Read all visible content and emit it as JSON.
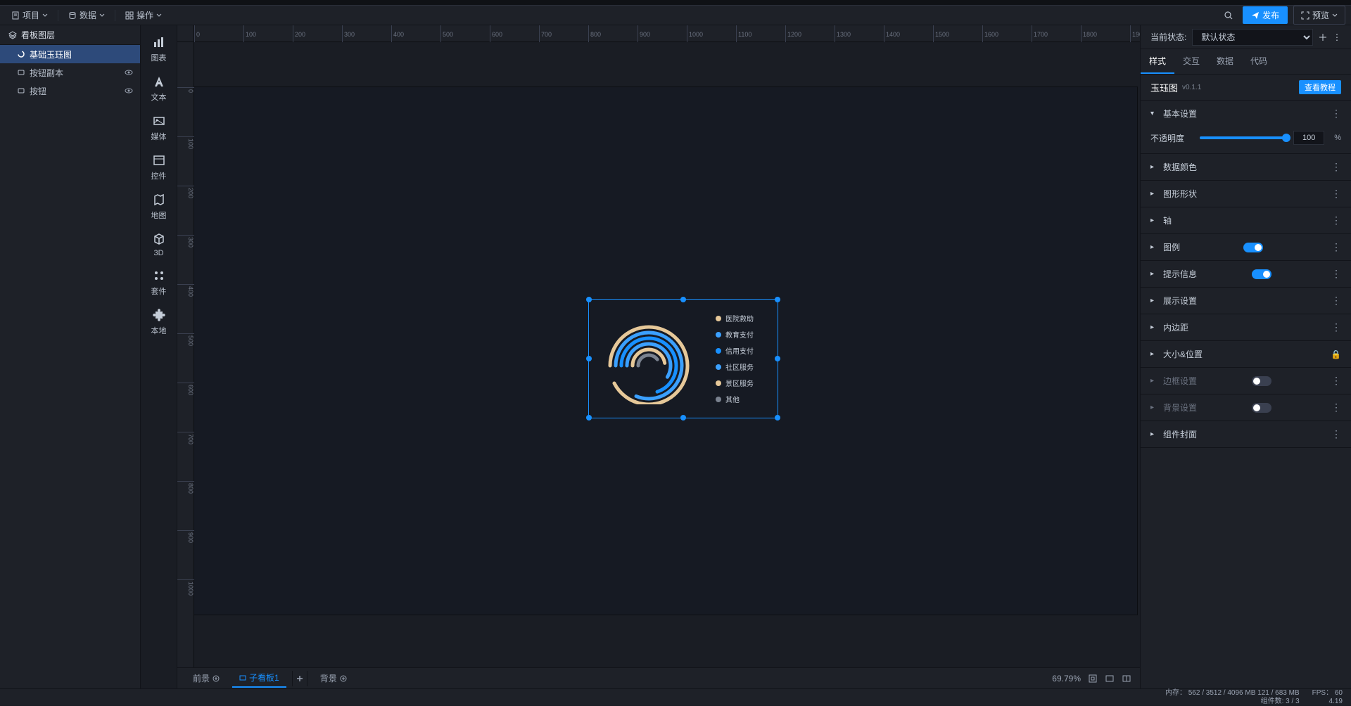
{
  "menubar": {
    "project": "项目",
    "data": "数据",
    "operate": "操作",
    "publish": "发布",
    "preview": "预览"
  },
  "layers": {
    "header": "看板图层",
    "items": [
      {
        "label": "基础玉珏图",
        "selected": true,
        "icon": "jade"
      },
      {
        "label": "按钮副本",
        "selected": false,
        "icon": "button",
        "eye": true
      },
      {
        "label": "按钮",
        "selected": false,
        "icon": "button",
        "eye": true
      }
    ]
  },
  "rail": [
    {
      "label": "图表",
      "icon": "chart"
    },
    {
      "label": "文本",
      "icon": "text"
    },
    {
      "label": "媒体",
      "icon": "media"
    },
    {
      "label": "控件",
      "icon": "control"
    },
    {
      "label": "地图",
      "icon": "map"
    },
    {
      "label": "3D",
      "icon": "cube"
    },
    {
      "label": "套件",
      "icon": "kit"
    },
    {
      "label": "本地",
      "icon": "puzzle"
    }
  ],
  "chart_data": {
    "type": "radial-bar",
    "title": "玉珏图",
    "series": [
      {
        "name": "医院救助",
        "value": 90,
        "color": "#e6c899"
      },
      {
        "name": "教育支付",
        "value": 75,
        "color": "#3ba0ff"
      },
      {
        "name": "信用支付",
        "value": 60,
        "color": "#1890ff"
      },
      {
        "name": "社区服务",
        "value": 45,
        "color": "#3ba0ff"
      },
      {
        "name": "景区服务",
        "value": 30,
        "color": "#e6c899"
      },
      {
        "name": "其他",
        "value": 20,
        "color": "#7a828f"
      }
    ]
  },
  "bottom_tabs": {
    "foreground": "前景",
    "sub_canvas": "子看板1",
    "background": "背景",
    "zoom": "69.79%"
  },
  "props": {
    "state_label": "当前状态:",
    "state_value": "默认状态",
    "tabs": {
      "style": "样式",
      "interact": "交互",
      "data": "数据",
      "code": "代码"
    },
    "title": "玉珏图",
    "version": "v0.1.1",
    "tutorial": "查看教程",
    "basic_settings": "基本设置",
    "opacity_label": "不透明度",
    "opacity_value": "100",
    "opacity_unit": "%",
    "sections": {
      "data_color": "数据颜色",
      "shape": "图形形状",
      "axis": "轴",
      "legend": "图例",
      "tooltip": "提示信息",
      "display": "展示设置",
      "padding": "内边距",
      "size_pos": "大小&位置",
      "border": "边框设置",
      "background": "背景设置",
      "cover": "组件封面"
    }
  },
  "status": {
    "memory": "内存： 562 / 3512 / 4096 MB  121 / 683 MB",
    "fps": "FPS： 60",
    "components": "组件数: 3 / 3",
    "version": "4.19"
  }
}
